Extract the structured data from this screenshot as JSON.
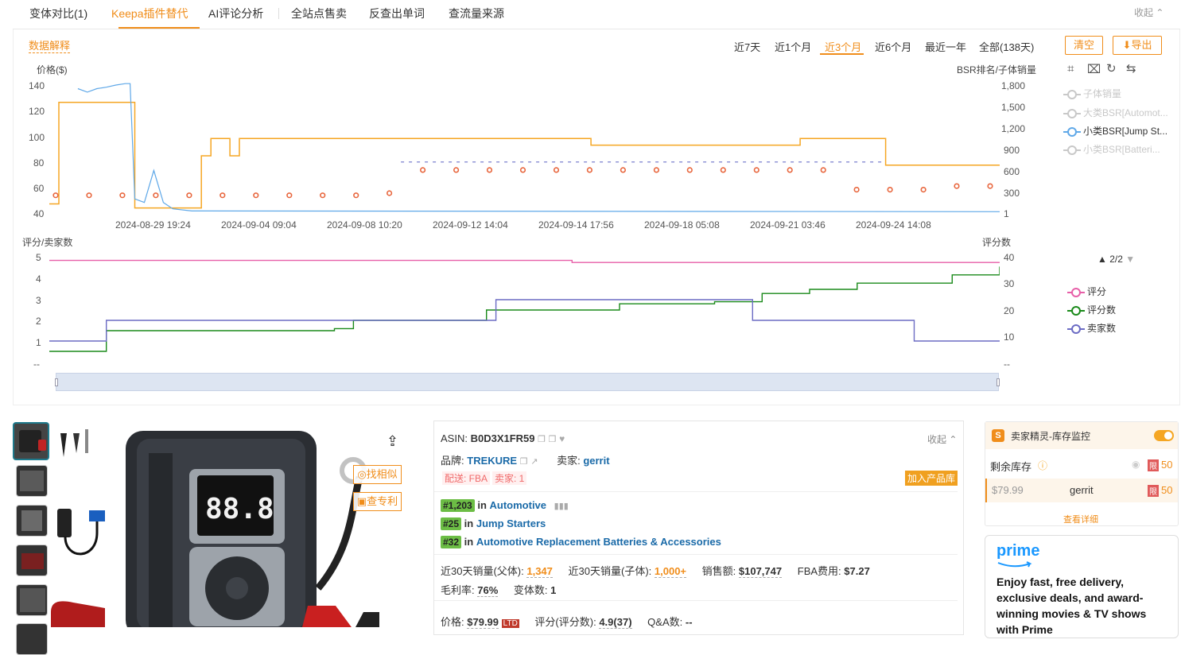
{
  "tabs": [
    {
      "label": "变体对比(1)"
    },
    {
      "label": "Keepa插件替代"
    },
    {
      "label": "AI评论分析"
    },
    {
      "label": "全站点售卖"
    },
    {
      "label": "反查出单词"
    },
    {
      "label": "查流量来源"
    }
  ],
  "collapse_label": "收起",
  "data_explain": "数据解释",
  "ranges": [
    "近7天",
    "近1个月",
    "近3个月",
    "近6个月",
    "最近一年",
    "全部(138天)"
  ],
  "active_range": "近3个月",
  "clear_label": "清空",
  "export_label": "导出",
  "chart_data": [
    {
      "type": "line",
      "ylabel": "价格($)",
      "y2label": "BSR排名/子体销量",
      "ylim": [
        40,
        140
      ],
      "yticks": [
        "140",
        "120",
        "100",
        "80",
        "60",
        "40"
      ],
      "y2ticks": [
        "1,800",
        "1,500",
        "1,200",
        "900",
        "600",
        "300",
        "1"
      ],
      "xticks": [
        "2024-08-29 19:24",
        "2024-09-04 09:04",
        "2024-09-08 10:20",
        "2024-09-12 14:04",
        "2024-09-14 17:56",
        "2024-09-18 05:08",
        "2024-09-21 03:46",
        "2024-09-24 14:08"
      ],
      "legend_position": "right",
      "grid": false,
      "series": [
        {
          "name": "子体销量",
          "color": "#c8c8c8",
          "active": false
        },
        {
          "name": "大类BSR[Automot...",
          "color": "#c8c8c8",
          "active": false
        },
        {
          "name": "小类BSR[Jump St...",
          "color": "#5fa8e8",
          "active": true
        },
        {
          "name": "小类BSR[Batteri...",
          "color": "#c8c8c8",
          "active": false
        }
      ],
      "price_series": {
        "color": "#f5a623",
        "points": [
          [
            0,
            51
          ],
          [
            1,
            51
          ],
          [
            1,
            127
          ],
          [
            9,
            127
          ],
          [
            9,
            48
          ],
          [
            10,
            48
          ],
          [
            16,
            48
          ],
          [
            16,
            87
          ],
          [
            17,
            87
          ],
          [
            17,
            100
          ],
          [
            18,
            100
          ],
          [
            19,
            100
          ],
          [
            19,
            87
          ],
          [
            20,
            87
          ],
          [
            20,
            100
          ],
          [
            21,
            100
          ],
          [
            36,
            100
          ],
          [
            37,
            100
          ],
          [
            37,
            100
          ],
          [
            57,
            100
          ],
          [
            57,
            95
          ],
          [
            79,
            95
          ],
          [
            79,
            100
          ],
          [
            88,
            100
          ],
          [
            88,
            80
          ],
          [
            100,
            80
          ]
        ]
      },
      "orange_dots": [
        [
          0,
          250
        ],
        [
          1,
          250
        ],
        [
          2,
          250
        ],
        [
          3,
          250
        ],
        [
          4,
          250
        ],
        [
          5,
          250
        ],
        [
          6,
          250
        ],
        [
          7,
          250
        ],
        [
          8,
          250
        ],
        [
          9,
          250
        ],
        [
          10,
          280
        ],
        [
          11,
          605
        ],
        [
          12,
          605
        ],
        [
          13,
          605
        ],
        [
          14,
          605
        ],
        [
          15,
          605
        ],
        [
          16,
          605
        ],
        [
          17,
          605
        ],
        [
          18,
          605
        ],
        [
          19,
          605
        ],
        [
          20,
          605
        ],
        [
          21,
          605
        ],
        [
          22,
          605
        ],
        [
          23,
          605
        ],
        [
          24,
          330
        ],
        [
          25,
          330
        ],
        [
          26,
          330
        ],
        [
          27,
          380
        ],
        [
          28,
          380
        ]
      ],
      "bsr_series": {
        "color": "#5fa8e8",
        "points": [
          [
            3,
            1750
          ],
          [
            4,
            1700
          ],
          [
            5,
            1750
          ],
          [
            6,
            1770
          ],
          [
            7,
            1800
          ],
          [
            8,
            1820
          ],
          [
            8.5,
            1820
          ],
          [
            9,
            200
          ],
          [
            10,
            150
          ],
          [
            11,
            600
          ],
          [
            12,
            150
          ],
          [
            13,
            60
          ],
          [
            15,
            30
          ],
          [
            100,
            20
          ]
        ]
      },
      "bsr_top_dashes": {
        "color": "#8f93d6",
        "points": [
          [
            37,
            720
          ],
          [
            60,
            720
          ],
          [
            88,
            720
          ]
        ]
      }
    },
    {
      "type": "line",
      "ylabel": "评分/卖家数",
      "y2label": "评分数",
      "ylim": [
        0,
        5
      ],
      "y2lim": [
        0,
        40
      ],
      "yticks": [
        "5",
        "4",
        "3",
        "2",
        "1",
        "--"
      ],
      "y2ticks": [
        "40",
        "30",
        "20",
        "10",
        "--"
      ],
      "legend_position": "right",
      "pager": "2/2",
      "series": [
        {
          "name": "评分",
          "color": "#e75fa8",
          "points": [
            [
              0,
              4.9
            ],
            [
              55,
              4.9
            ],
            [
              55,
              4.8
            ],
            [
              100,
              4.8
            ]
          ]
        },
        {
          "name": "评分数",
          "color": "#1a8a1a",
          "points": [
            [
              0,
              0.5
            ],
            [
              6,
              1.0
            ],
            [
              6,
              1.5
            ],
            [
              30,
              1.6
            ],
            [
              32,
              2.0
            ],
            [
              46,
              2.2
            ],
            [
              46,
              2.5
            ],
            [
              60,
              2.8
            ],
            [
              70,
              2.9
            ],
            [
              75,
              3.3
            ],
            [
              80,
              3.5
            ],
            [
              85,
              3.8
            ],
            [
              95,
              4.2
            ],
            [
              100,
              4.6
            ]
          ]
        },
        {
          "name": "卖家数",
          "color": "#6b6bc4",
          "points": [
            [
              0,
              1
            ],
            [
              6,
              1
            ],
            [
              6,
              2
            ],
            [
              47,
              2
            ],
            [
              47,
              3
            ],
            [
              74,
              3
            ],
            [
              74,
              2
            ],
            [
              91,
              2
            ],
            [
              91,
              1
            ],
            [
              100,
              1
            ]
          ]
        }
      ]
    }
  ],
  "product": {
    "asin_label": "ASIN:",
    "asin": "B0D3X1FR59",
    "brand_label": "品牌:",
    "brand": "TREKURE",
    "seller_label": "卖家:",
    "seller": "gerrit",
    "ship_tag": "配送: FBA",
    "seller_count_tag": "卖家: 1",
    "add_to_lib": "加入产品库",
    "collapse_label": "收起",
    "find_similar": "找相似",
    "check_patent": "查专利",
    "ranks": [
      {
        "rank": "#1,203",
        "in": "in",
        "category": "Automotive"
      },
      {
        "rank": "#25",
        "in": "in",
        "category": "Jump Starters"
      },
      {
        "rank": "#32",
        "in": "in",
        "category": "Automotive Replacement Batteries & Accessories"
      }
    ],
    "stats": {
      "parent_sales_label": "近30天销量(父体):",
      "parent_sales": "1,347",
      "child_sales_label": "近30天销量(子体):",
      "child_sales": "1,000+",
      "revenue_label": "销售额:",
      "revenue": "$107,747",
      "fba_fee_label": "FBA费用:",
      "fba_fee": "$7.27",
      "margin_label": "毛利率:",
      "margin": "76%",
      "variants_label": "变体数:",
      "variants": "1",
      "price_label": "价格:",
      "price": "$79.99",
      "ltd": "LTD",
      "rating_label": "评分(评分数):",
      "rating": "4.9(37)",
      "qa_label": "Q&A数:",
      "qa": "--"
    }
  },
  "stock": {
    "title": "卖家精灵-库存监控",
    "remaining_label": "剩余库存",
    "remaining_value": "50",
    "limit_tag": "限",
    "row_price": "$79.99",
    "row_seller": "gerrit",
    "row_value": "50",
    "detail_link": "查看详细"
  },
  "prime": {
    "logo": "prime",
    "text": "Enjoy fast, free delivery, exclusive deals, and award-winning movies & TV shows with Prime"
  },
  "colors": {
    "accent": "#f08d1a",
    "link": "#1a6aa8",
    "rank_badge": "#6cbd45"
  }
}
